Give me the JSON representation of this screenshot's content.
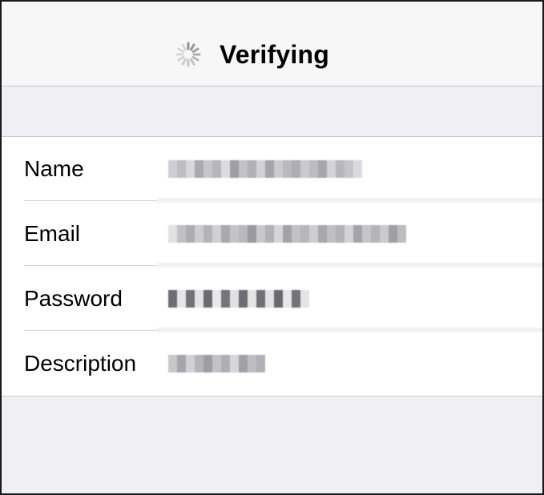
{
  "navbar": {
    "title": "Verifying",
    "spinner_icon": "activity-spinner-icon"
  },
  "form": {
    "rows": [
      {
        "label": "Name",
        "value_state": "redacted-pixelated"
      },
      {
        "label": "Email",
        "value_state": "redacted-pixelated"
      },
      {
        "label": "Password",
        "value_state": "masked-pixelated"
      },
      {
        "label": "Description",
        "value_state": "redacted-pixelated"
      }
    ]
  },
  "colors": {
    "background": "#efeff4",
    "navbar": "#f7f7f7",
    "cell": "#ffffff",
    "separator": "#c8c7cc",
    "text": "#000000"
  }
}
